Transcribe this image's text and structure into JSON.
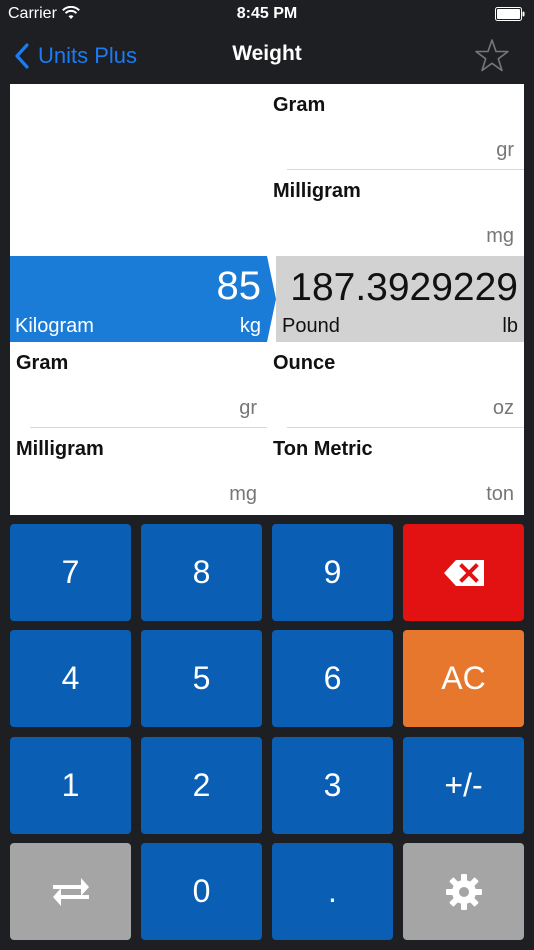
{
  "status_bar": {
    "carrier": "Carrier",
    "time": "8:45 PM",
    "icons": [
      "wifi-icon",
      "battery-icon"
    ]
  },
  "nav": {
    "back_label": "Units Plus",
    "title": "Weight",
    "favorite_icon": "star-outline-icon"
  },
  "colors": {
    "accent": "#1a7cf4",
    "active_cell": "#1a7cd6",
    "key_blue": "#0a5fb5",
    "key_red": "#e21212",
    "key_orange": "#e8772e",
    "key_gray": "#a5a5a5",
    "result_bg": "#d2d2d2"
  },
  "units": {
    "top_right": [
      {
        "name": "Gram",
        "abbr": "gr"
      },
      {
        "name": "Milligram",
        "abbr": "mg"
      }
    ],
    "input": {
      "value": "85",
      "name": "Kilogram",
      "abbr": "kg"
    },
    "result": {
      "value": "187.3929229",
      "name": "Pound",
      "abbr": "lb"
    },
    "left_list": [
      {
        "name": "Gram",
        "abbr": "gr"
      },
      {
        "name": "Milligram",
        "abbr": "mg"
      }
    ],
    "right_list": [
      {
        "name": "Ounce",
        "abbr": "oz"
      },
      {
        "name": "Ton Metric",
        "abbr": "ton"
      }
    ]
  },
  "keypad": {
    "k7": "7",
    "k8": "8",
    "k9": "9",
    "k4": "4",
    "k5": "5",
    "k6": "6",
    "k1": "1",
    "k2": "2",
    "k3": "3",
    "k0": "0",
    "dot": ".",
    "clear": "AC",
    "sign": "+/-",
    "backspace_icon": "backspace-icon",
    "swap_icon": "swap-arrows-icon",
    "settings_icon": "gear-icon"
  }
}
